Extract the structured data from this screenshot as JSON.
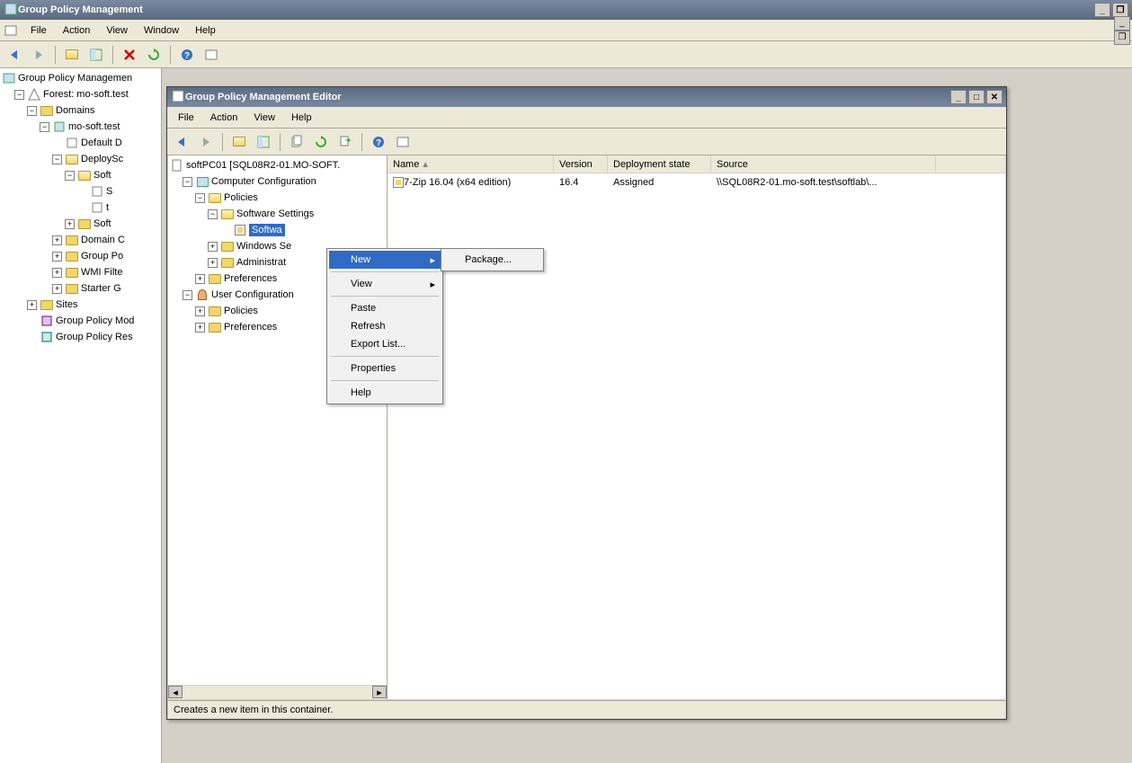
{
  "outer": {
    "title": "Group Policy Management",
    "menus": {
      "file": "File",
      "action": "Action",
      "view": "View",
      "window": "Window",
      "help": "Help"
    },
    "tree": {
      "root": "Group Policy Managemen",
      "forest": "Forest: mo-soft.test",
      "domains": "Domains",
      "domain": "mo-soft.test",
      "defaultdc": "Default D",
      "deploysc": "DeploySc",
      "soft1": "Soft",
      "soft_s": "S",
      "soft_t": "t",
      "soft2": "Soft",
      "domainc": "Domain C",
      "grouppo": "Group Po",
      "wmifilte": "WMI Filte",
      "starterg": "Starter G",
      "sites": "Sites",
      "gpmod": "Group Policy Mod",
      "gpres": "Group Policy Res"
    }
  },
  "editor": {
    "title": "Group Policy Management Editor",
    "menus": {
      "file": "File",
      "action": "Action",
      "view": "View",
      "help": "Help"
    },
    "tree": {
      "root": "softPC01 [SQL08R2-01.MO-SOFT.",
      "compconf": "Computer Configuration",
      "policies": "Policies",
      "softset": "Software Settings",
      "softinst": "Softwa",
      "winse": "Windows Se",
      "admin": "Administrat",
      "prefs": "Preferences",
      "userconf": "User Configuration",
      "upolicies": "Policies",
      "uprefs": "Preferences"
    },
    "list": {
      "cols": {
        "name": "Name",
        "version": "Version",
        "deploy": "Deployment state",
        "source": "Source"
      },
      "row": {
        "name": "7-Zip 16.04 (x64 edition)",
        "version": "16.4",
        "deploy": "Assigned",
        "source": "\\\\SQL08R2-01.mo-soft.test\\softlab\\..."
      }
    },
    "status": "Creates a new item in this container."
  },
  "context": {
    "new": "New",
    "view": "View",
    "paste": "Paste",
    "refresh": "Refresh",
    "export": "Export List...",
    "properties": "Properties",
    "help": "Help",
    "package": "Package..."
  }
}
